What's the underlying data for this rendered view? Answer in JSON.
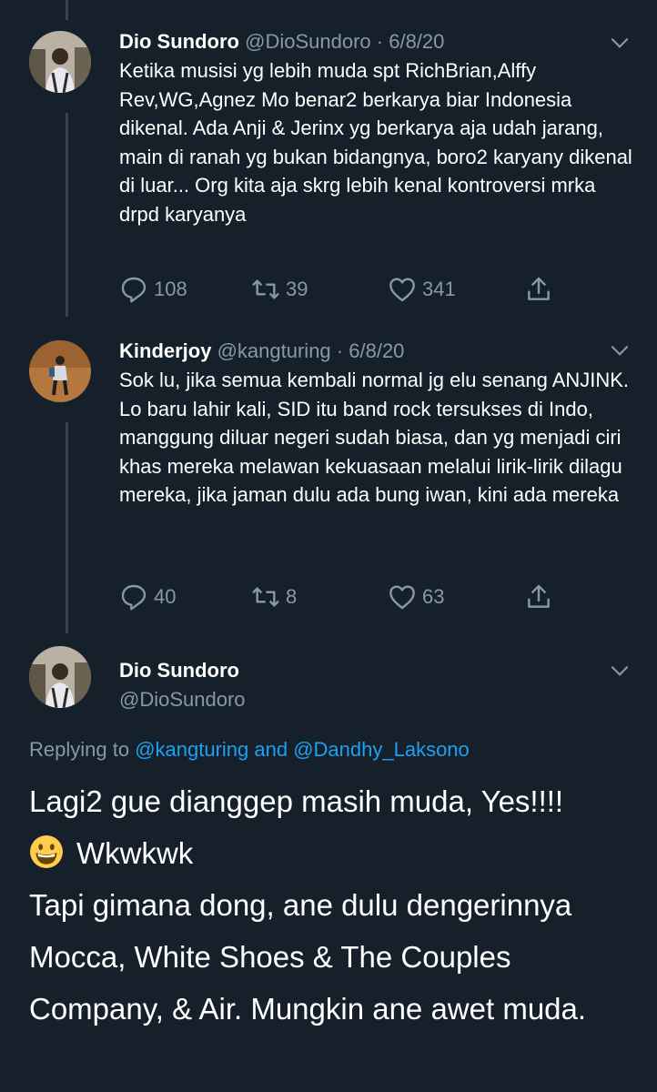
{
  "tweets": [
    {
      "name": "Dio Sundoro",
      "handle": "@DioSundoro",
      "separator": "·",
      "date": "6/8/20",
      "text": "Ketika musisi yg lebih muda spt RichBrian,Alffy Rev,WG,Agnez Mo benar2 berkarya biar Indonesia dikenal. Ada Anji & Jerinx yg berkarya aja udah jarang, main di ranah yg bukan bidangnya, boro2 karyany dikenal di luar... Org kita aja skrg lebih kenal kontroversi mrka drpd karyanya",
      "replies": "108",
      "retweets": "39",
      "likes": "341"
    },
    {
      "name": "Kinderjoy",
      "handle": "@kangturing",
      "separator": "·",
      "date": "6/8/20",
      "text": "Sok lu, jika semua kembali normal jg elu senang ANJINK.\nLo baru lahir kali, SID itu band rock tersukses di Indo, manggung diluar negeri sudah biasa, dan yg menjadi ciri khas mereka melawan kekuasaan melalui lirik-lirik dilagu mereka, jika jaman dulu ada bung iwan, kini ada mereka",
      "replies": "40",
      "retweets": "8",
      "likes": "63"
    }
  ],
  "main_tweet": {
    "name": "Dio Sundoro",
    "handle": "@DioSundoro",
    "replying_prefix": "Replying to",
    "replying_mentions": "@kangturing and @Dandhy_Laksono",
    "line1": "Lagi2 gue dianggep masih muda, Yes!!!!",
    "line2": "Wkwkwk",
    "line3": "Tapi gimana dong, ane dulu dengerinnya Mocca, White Shoes & The Couples Company, & Air. Mungkin ane awet muda.",
    "emoji": "grinning-face-emoji"
  },
  "colors": {
    "background": "#15202b",
    "secondary_text": "#8899a6",
    "link": "#1da1f2"
  }
}
